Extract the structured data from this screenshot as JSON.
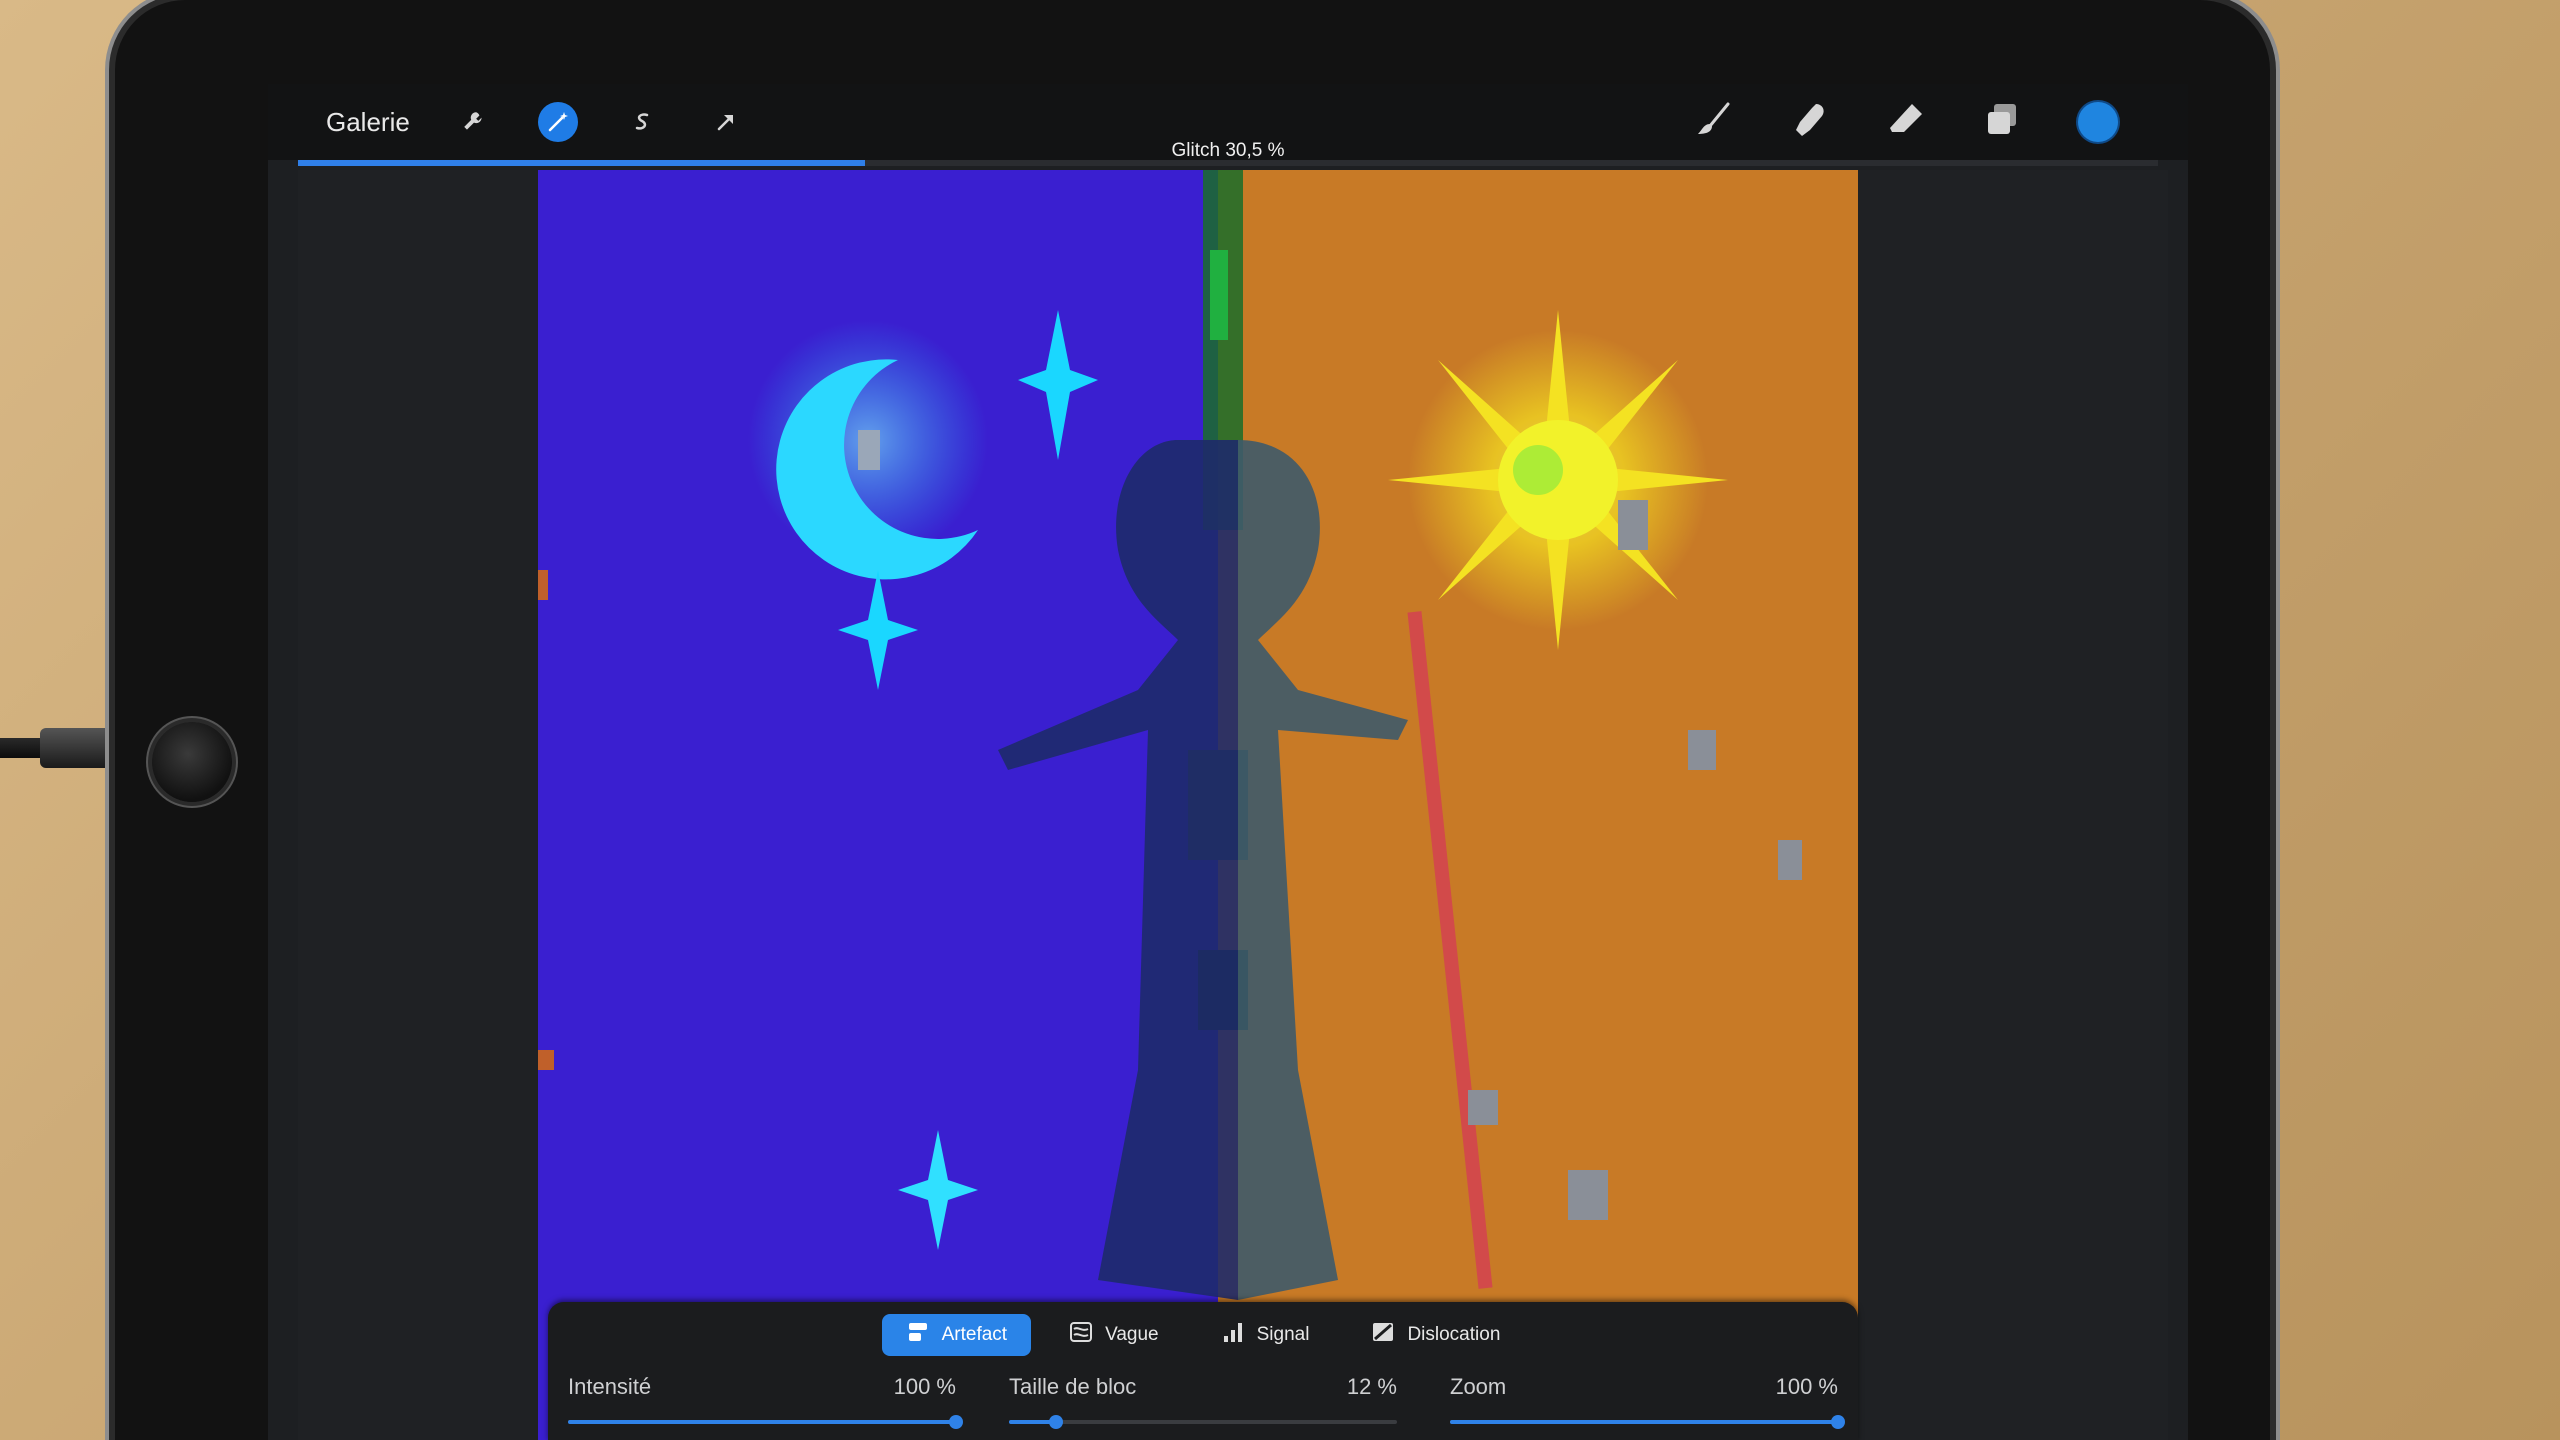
{
  "app": {
    "gallery_label": "Galerie",
    "progress_label": "Glitch 30,5 %",
    "progress_value": 0.305
  },
  "toolbar": {
    "left_tools": [
      {
        "name": "wrench-icon",
        "glyph": "🔧"
      },
      {
        "name": "magic-wand-icon",
        "glyph": "✨",
        "active": true
      },
      {
        "name": "selection-icon",
        "glyph": "S"
      },
      {
        "name": "transform-arrow-icon",
        "glyph": "➚"
      }
    ],
    "right_tools": [
      "brush-icon",
      "smudge-icon",
      "eraser-icon",
      "layers-icon",
      "color-icon"
    ],
    "active_color": "#1f85e0"
  },
  "effect_panel": {
    "tabs": [
      {
        "label": "Artefact",
        "icon": "artifact-icon",
        "active": true
      },
      {
        "label": "Vague",
        "icon": "wave-icon",
        "active": false
      },
      {
        "label": "Signal",
        "icon": "signal-icon",
        "active": false
      },
      {
        "label": "Dislocation",
        "icon": "dislocation-icon",
        "active": false
      }
    ],
    "sliders": [
      {
        "label": "Intensité",
        "value_text": "100 %",
        "value": 1.0
      },
      {
        "label": "Taille de bloc",
        "value_text": "12 %",
        "value": 0.12
      },
      {
        "label": "Zoom",
        "value_text": "100 %",
        "value": 1.0
      }
    ]
  },
  "colors": {
    "night_bg": "#3a1fd0",
    "day_bg": "#c87a26",
    "accent": "#2f82e8"
  }
}
